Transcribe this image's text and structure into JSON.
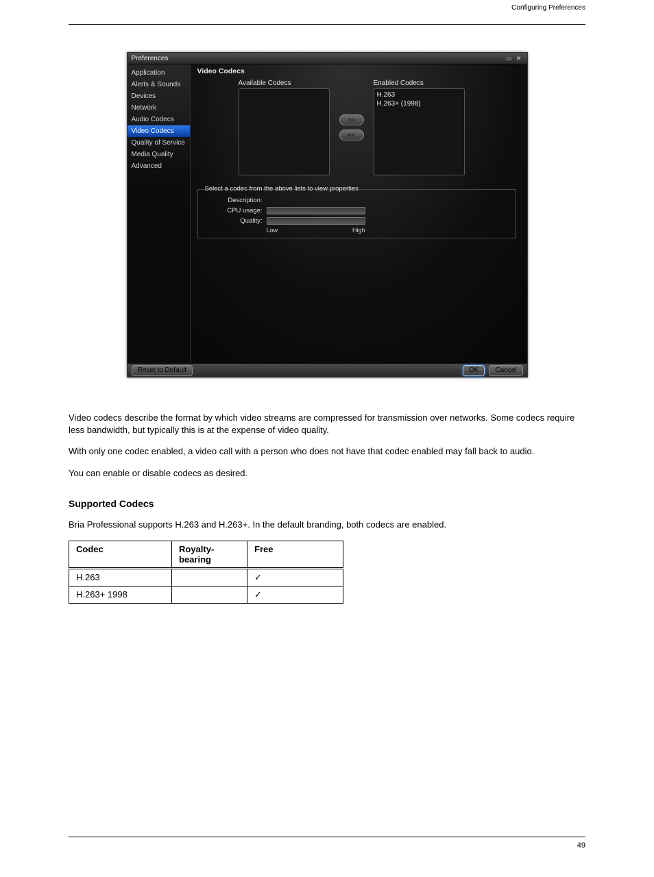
{
  "header": {
    "right_text": "Configuring Preferences"
  },
  "window": {
    "title": "Preferences",
    "sidebar": {
      "items": [
        {
          "label": "Application",
          "selected": false
        },
        {
          "label": "Alerts & Sounds",
          "selected": false
        },
        {
          "label": "Devices",
          "selected": false
        },
        {
          "label": "Network",
          "selected": false
        },
        {
          "label": "Audio Codecs",
          "selected": false
        },
        {
          "label": "Video Codecs",
          "selected": true
        },
        {
          "label": "Quality of Service",
          "selected": false
        },
        {
          "label": "Media Quality",
          "selected": false
        },
        {
          "label": "Advanced",
          "selected": false
        }
      ]
    },
    "section_title": "Video Codecs",
    "available_label": "Available Codecs",
    "enabled_label": "Enabled Codecs",
    "enabled_items": [
      "H.263",
      "H.263+ (1998)"
    ],
    "move_right": ">>",
    "move_left": "<<",
    "props_legend": "Select a codec from the above lists to view properties",
    "desc_label": "Description:",
    "cpu_label": "CPU usage:",
    "quality_label": "Quality:",
    "scale_low": "Low",
    "scale_high": "High",
    "reset_label": "Reset to Default",
    "ok_label": "OK",
    "cancel_label": "Cancel"
  },
  "body": {
    "p1": "Video codecs describe the format by which video streams are compressed for transmission over networks. Some codecs require less bandwidth, but typically this is at the expense of video quality.",
    "p2": "With only one codec enabled, a video call with a person who does not have that codec enabled may fall back to audio.",
    "p3": "You can enable or disable codecs as desired.",
    "subhead": "Supported Codecs",
    "p4": "Bria Professional supports H.263 and H.263+. In the default branding, both codecs are enabled."
  },
  "table": {
    "headers": [
      "Codec",
      "Royalty-bearing",
      "Free"
    ],
    "rows": [
      {
        "codec": "H.263",
        "royalty": "",
        "free": "✓"
      },
      {
        "codec": "H.263+ 1998",
        "royalty": "",
        "free": "✓"
      }
    ]
  },
  "footer": {
    "page": "49"
  }
}
